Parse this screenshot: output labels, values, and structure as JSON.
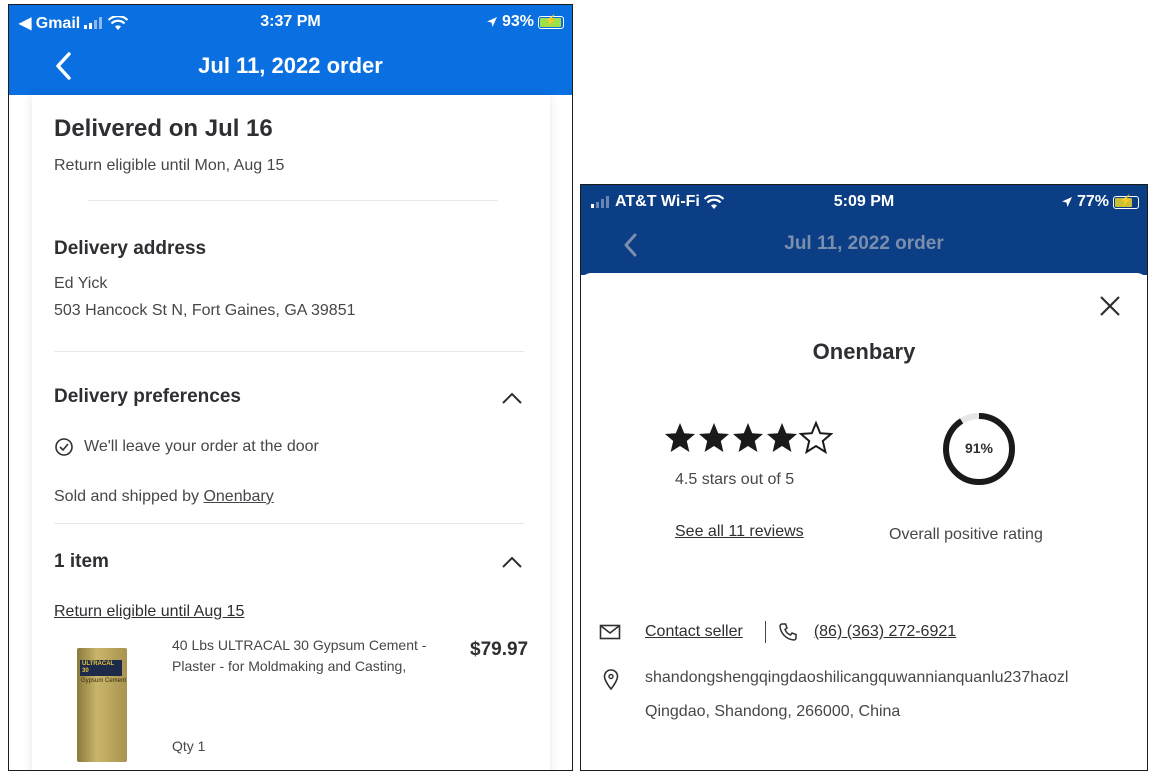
{
  "left": {
    "status": {
      "carrier": "◀ Gmail",
      "time": "3:37 PM",
      "battery": "93%"
    },
    "header": {
      "title": "Jul 11, 2022 order"
    },
    "delivery": {
      "title": "Delivered on Jul 16",
      "return_note": "Return eligible until Mon, Aug 15"
    },
    "address": {
      "heading": "Delivery address",
      "name": "Ed Yick",
      "street": "503 Hancock St N, Fort Gaines, GA 39851"
    },
    "preferences": {
      "heading": "Delivery preferences",
      "option": "We'll leave your order at the door"
    },
    "sold_by": {
      "prefix": "Sold and shipped by ",
      "seller": "Onenbary"
    },
    "items": {
      "heading": "1 item",
      "return_link": "Return eligible until Aug 15",
      "product": {
        "title_line1": "40 Lbs ULTRACAL 30 Gypsum Cement -",
        "title_line2": "Plaster - for Moldmaking and Casting,",
        "price": "$79.97",
        "qty": "Qty 1",
        "image_label": "ULTRACAL 30",
        "image_sub": "Gypsum Cement"
      }
    }
  },
  "right": {
    "status": {
      "carrier": "AT&T Wi-Fi",
      "time": "5:09 PM",
      "battery": "77%"
    },
    "header": {
      "title": "Jul 11, 2022 order"
    },
    "seller": {
      "name": "Onenbary",
      "stars_text": "4.5 stars out of 5",
      "star_rating": 4.5,
      "reviews_link": "See all 11 reviews",
      "positive_pct_label": "91%",
      "positive_fraction": 0.91,
      "positive_text": "Overall positive rating",
      "contact_link": "Contact seller",
      "phone": "(86) (363) 272-6921",
      "address_line1": "shandongshengqingdaoshilicangquwannianquanlu237haozl",
      "address_line2": "Qingdao, Shandong, 266000, China"
    }
  },
  "colors": {
    "header_blue": "#0a6fe0",
    "header_dim_blue": "#0b3e84",
    "text": "#2e2f32"
  }
}
